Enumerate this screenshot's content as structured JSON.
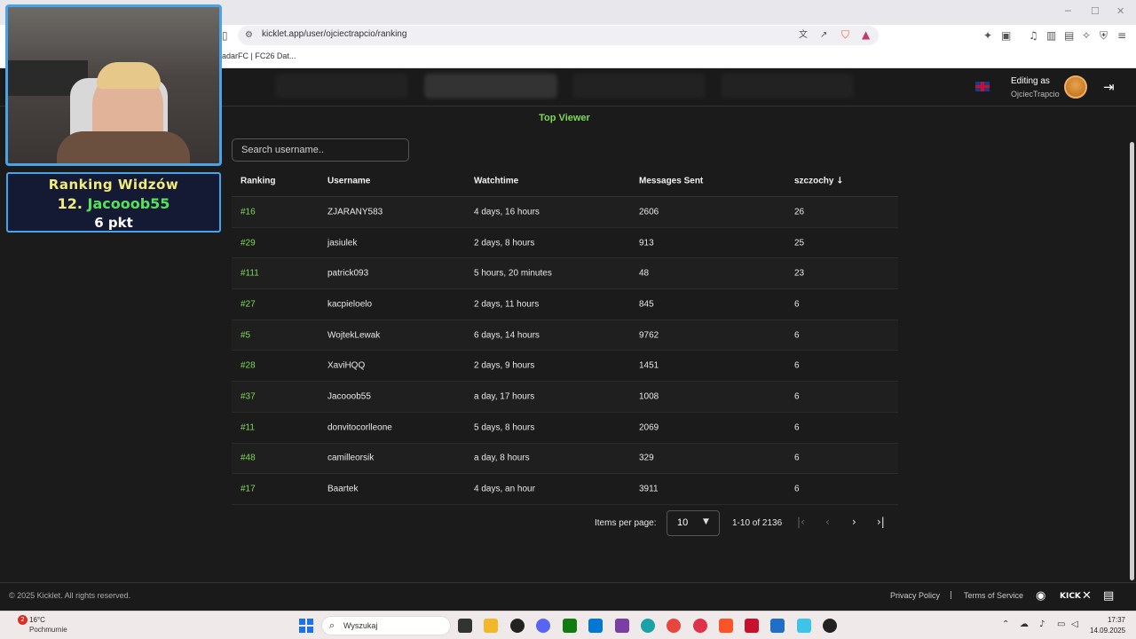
{
  "browser": {
    "url": "kicklet.app/user/ojciectrapcio/ranking",
    "bookmark": "adarFC | FC26 Dat..."
  },
  "nav": {
    "editing_label": "Editing as",
    "editing_user": "OjciecTrapcio"
  },
  "overlay": {
    "panel_title": "Ranking Widzów",
    "position": "12.",
    "username": "Jacooob55",
    "points": "6 pkt"
  },
  "page": {
    "section_title": "Top Viewer",
    "search_placeholder": "Search username.."
  },
  "table": {
    "headers": [
      "Ranking",
      "Username",
      "Watchtime",
      "Messages Sent",
      "szczochy"
    ],
    "sort_indicator": "↓",
    "rows": [
      [
        "#16",
        "ZJARANY583",
        "4 days, 16 hours",
        "2606",
        "26"
      ],
      [
        "#29",
        "jasiulek",
        "2 days, 8 hours",
        "913",
        "25"
      ],
      [
        "#111",
        "patrick093",
        "5 hours, 20 minutes",
        "48",
        "23"
      ],
      [
        "#27",
        "kacpieloelo",
        "2 days, 11 hours",
        "845",
        "6"
      ],
      [
        "#5",
        "WojtekLewak",
        "6 days, 14 hours",
        "9762",
        "6"
      ],
      [
        "#28",
        "XaviHQQ",
        "2 days, 9 hours",
        "1451",
        "6"
      ],
      [
        "#37",
        "Jacooob55",
        "a day, 17 hours",
        "1008",
        "6"
      ],
      [
        "#11",
        "donvitocorlleone",
        "5 days, 8 hours",
        "2069",
        "6"
      ],
      [
        "#48",
        "camilleorsik",
        "a day, 8 hours",
        "329",
        "6"
      ],
      [
        "#17",
        "Baartek",
        "4 days, an hour",
        "3911",
        "6"
      ]
    ]
  },
  "pagination": {
    "items_per_page_label": "Items per page:",
    "items_per_page_value": "10",
    "range": "1-10 of 2136"
  },
  "footer": {
    "copyright": "© 2025 Kicklet. All rights reserved.",
    "privacy": "Privacy Policy",
    "separator": "|",
    "terms": "Terms of Service",
    "kick_label": "KICK"
  },
  "taskbar": {
    "weather_badge": "2",
    "weather_temp": "16°C",
    "weather_desc": "Pochmurnie",
    "search_text": "Wyszukaj",
    "time": "17:37",
    "date": "14.09.2025"
  },
  "colors": {
    "accent_green": "#7ed957",
    "overlay_border": "#4aa3e6",
    "overlay_title": "#f2ec7b",
    "overlay_name": "#53e35b"
  }
}
